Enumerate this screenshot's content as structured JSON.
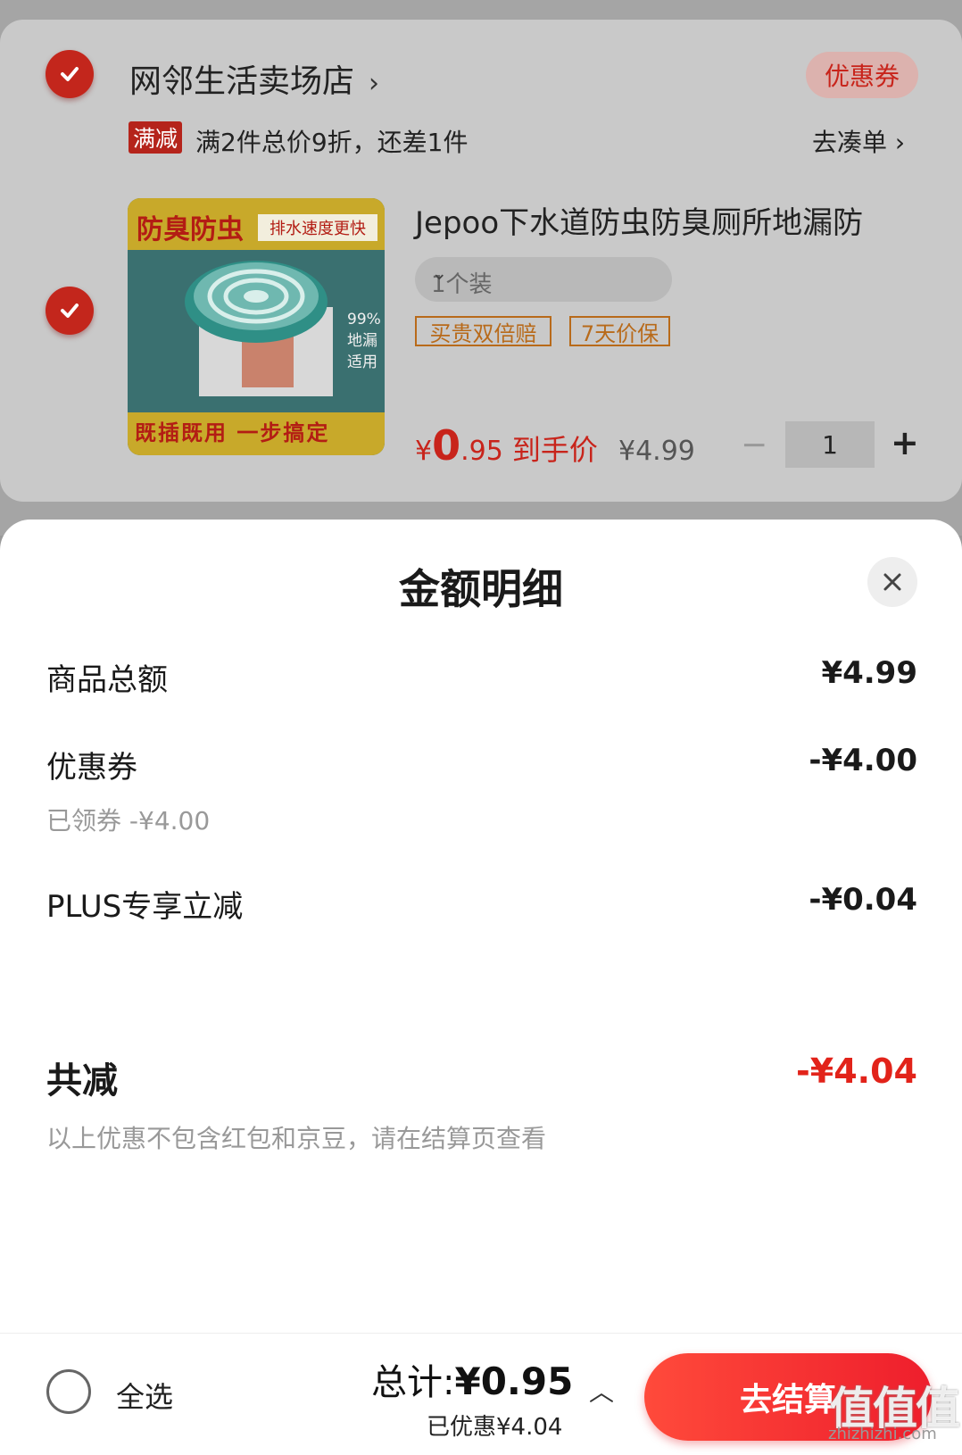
{
  "store": {
    "name": "网邻生活卖场店",
    "chevron": "›",
    "coupon_label": "优惠券",
    "promo_tag": "满减",
    "promo_text": "满2件总价9折，还差1件",
    "make_order": "去凑单 ›"
  },
  "product": {
    "title": "Jepoo下水道防虫防臭厕所地漏防",
    "image_text_top": "防臭防虫",
    "image_text_tag": "排水速度更快",
    "image_text_side": "99%地漏适用",
    "image_text_bottom": "既插既用 一步搞定",
    "spec": "1个装",
    "spec_dropdown": "⌄",
    "badges": [
      "买贵双倍赔",
      "7天价保"
    ],
    "price_symbol": "¥",
    "price_int": "0",
    "price_dec": ".95",
    "price_label": "到手价",
    "original_price": "¥4.99",
    "minus": "−",
    "quantity": "1",
    "plus": "+"
  },
  "sheet": {
    "title": "金额明细",
    "rows": [
      {
        "label": "商品总额",
        "value": "¥4.99"
      },
      {
        "label": "优惠券",
        "value": "-¥4.00",
        "sub": "已领券 -¥4.00"
      },
      {
        "label": "PLUS专享立减",
        "value": "-¥0.04"
      }
    ],
    "total_label": "共减",
    "total_value": "-¥4.04",
    "note": "以上优惠不包含红包和京豆，请在结算页查看"
  },
  "footer": {
    "select_all": "全选",
    "total_prefix": "总计:",
    "total_value": "¥0.95",
    "saved": "已优惠¥4.04",
    "caret": "︿",
    "checkout": "去结算"
  },
  "watermark": {
    "text": "值值值",
    "url": "zhizhizhi.com"
  },
  "colors": {
    "accent": "#e2231a",
    "check": "#c3261c",
    "badge": "#b86a1a"
  }
}
